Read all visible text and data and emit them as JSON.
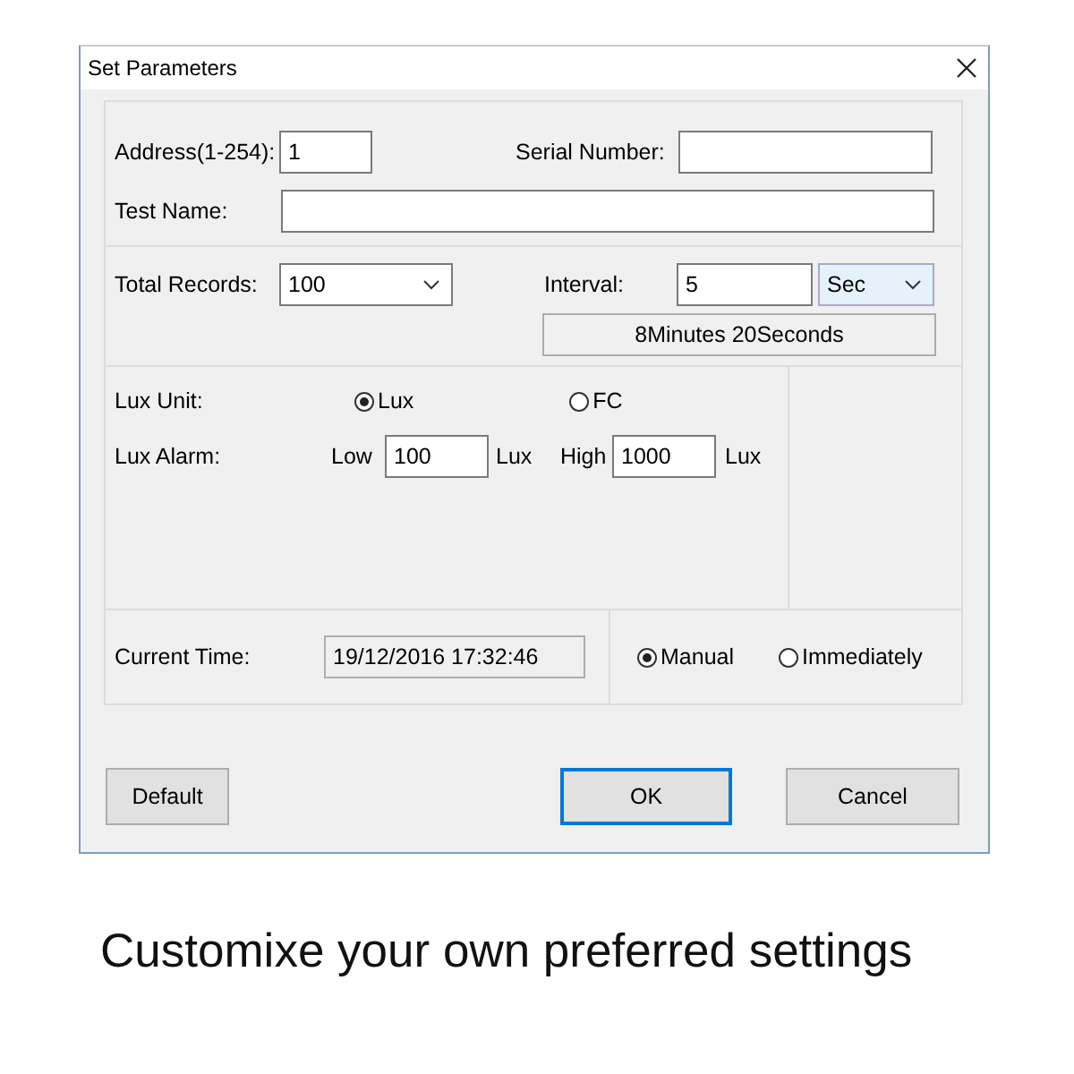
{
  "window": {
    "title": "Set Parameters"
  },
  "address": {
    "label": "Address(1-254):",
    "value": "1"
  },
  "serial_number": {
    "label": "Serial Number:"
  },
  "test_name": {
    "label": "Test Name:"
  },
  "total_records": {
    "label": "Total Records:",
    "value": "100"
  },
  "interval": {
    "label": "Interval:",
    "value": "5",
    "unit": "Sec",
    "duration": "8Minutes 20Seconds"
  },
  "lux_unit": {
    "label": "Lux Unit:",
    "options": [
      {
        "label": "Lux",
        "selected": true
      },
      {
        "label": "FC",
        "selected": false
      }
    ]
  },
  "lux_alarm": {
    "label": "Lux Alarm:",
    "low_label": "Low",
    "low": "100",
    "low_unit": "Lux",
    "high_label": "High",
    "high": "1000",
    "high_unit": "Lux"
  },
  "current_time": {
    "label": "Current Time:",
    "value": "19/12/2016 17:32:46",
    "options": [
      {
        "label": "Manual",
        "selected": true
      },
      {
        "label": "Immediately",
        "selected": false
      }
    ]
  },
  "buttons": [
    {
      "label": "Default",
      "focused": false
    },
    {
      "label": "OK",
      "focused": true
    },
    {
      "label": "Cancel",
      "focused": false
    }
  ],
  "caption": "Customixe your own preferred settings"
}
